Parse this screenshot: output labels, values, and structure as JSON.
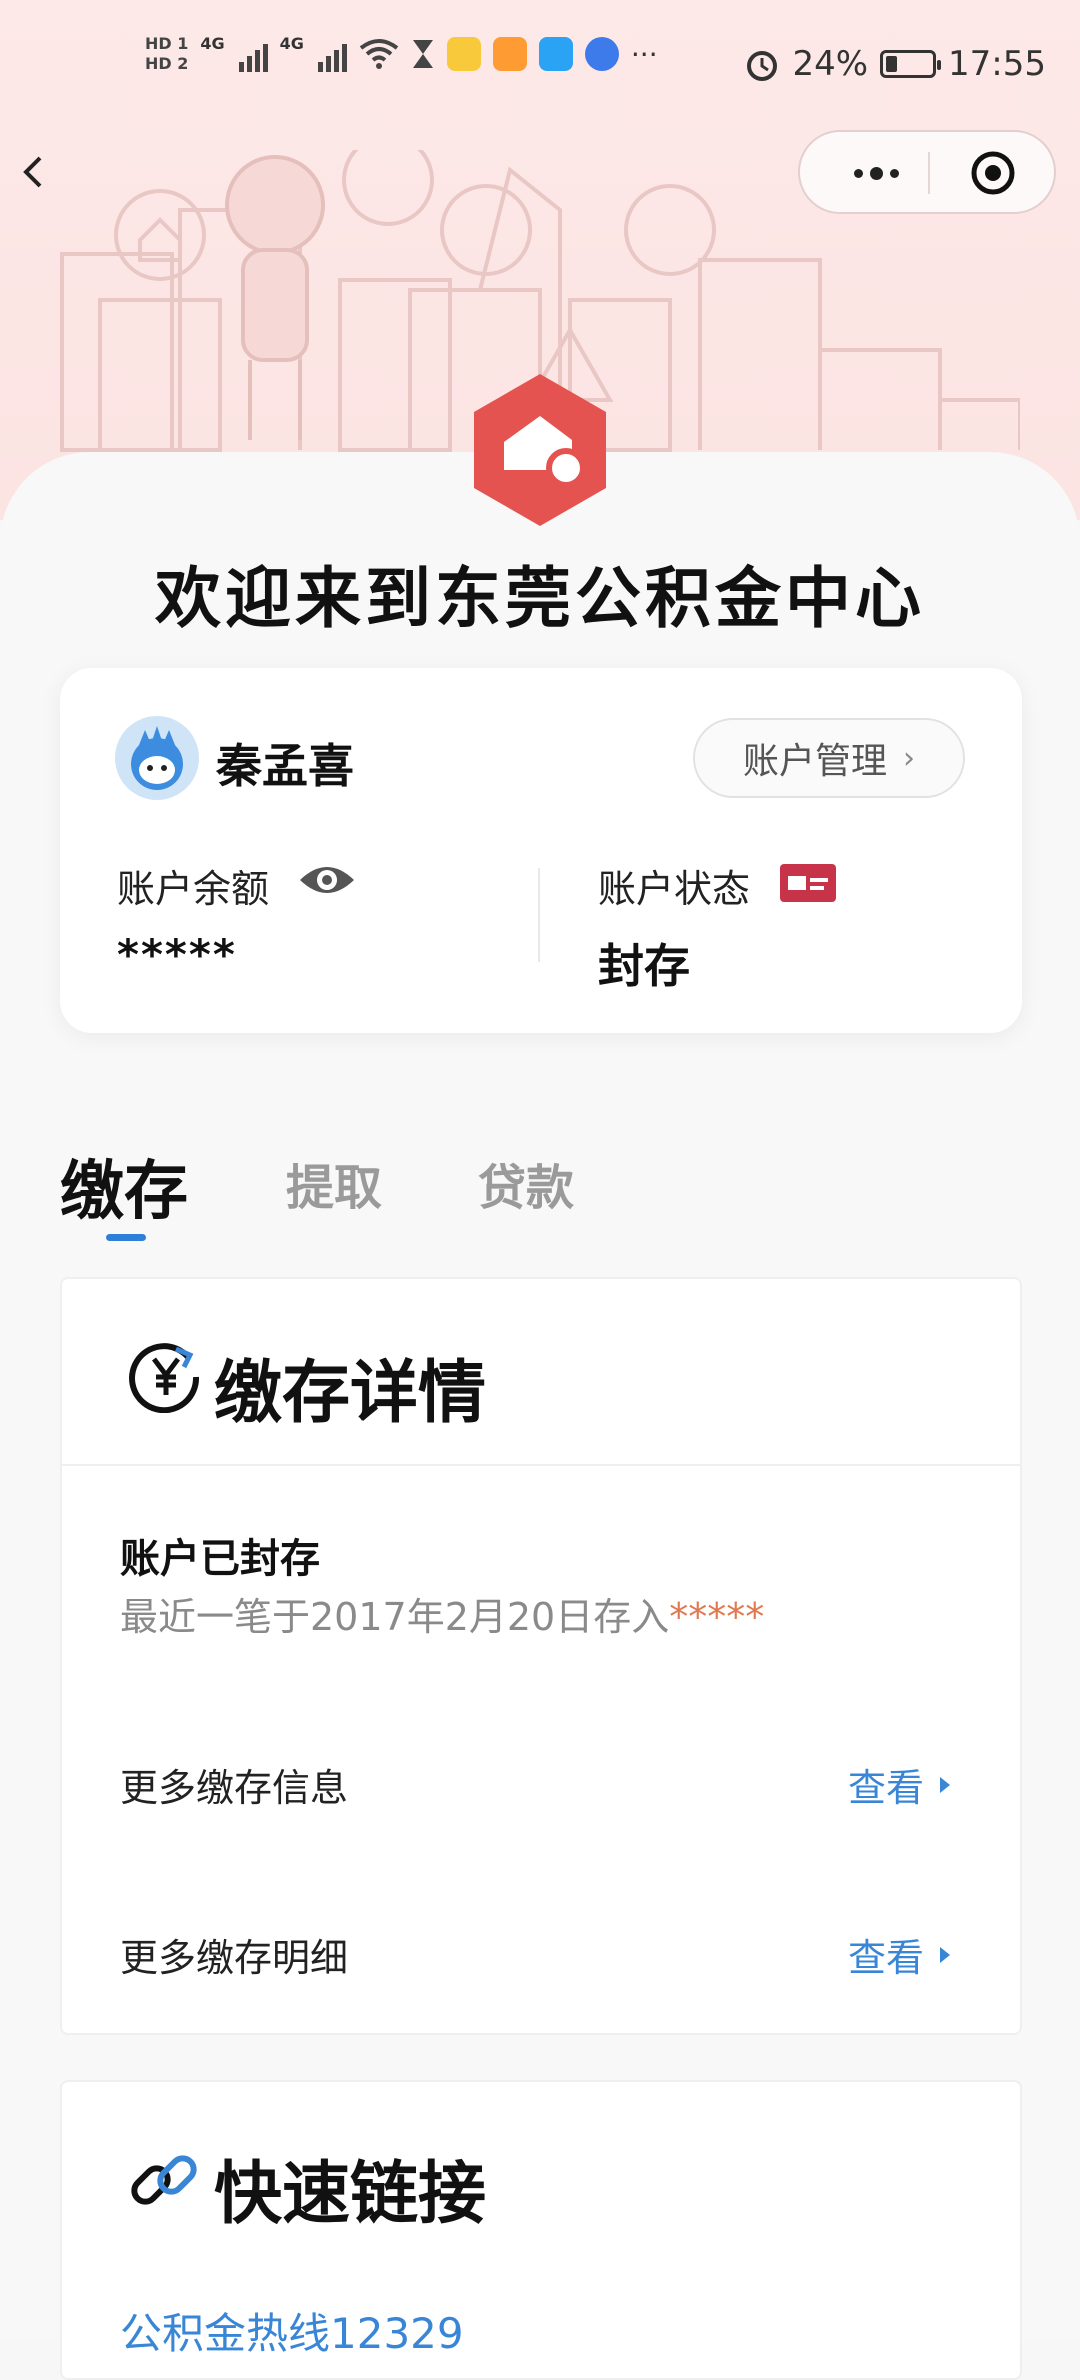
{
  "status_bar": {
    "hd1": "HD 1",
    "hd2": "HD 2",
    "network1": "4G",
    "network2": "4G",
    "more": "···",
    "battery_percent": "24%",
    "battery_level": 0.24,
    "time": "17:55"
  },
  "nav": {
    "back_icon": "chevron-left-icon",
    "more_icon": "more-dots-icon",
    "close_icon": "target-circle-icon"
  },
  "welcome_title": "欢迎来到东莞公积金中心",
  "account": {
    "user_name": "秦孟喜",
    "manage_label": "账户管理",
    "manage_chevron": "›",
    "balance_label": "账户余额",
    "balance_value": "*****",
    "status_label": "账户状态",
    "status_value": "封存"
  },
  "tabs": [
    {
      "label": "缴存",
      "active": true
    },
    {
      "label": "提取",
      "active": false
    },
    {
      "label": "贷款",
      "active": false
    }
  ],
  "deposit_details": {
    "title": "缴存详情",
    "sealed_title": "账户已封存",
    "sealed_sub_prefix": "最近一笔于2017年2月20日存入",
    "sealed_sub_mask": "*****",
    "rows": [
      {
        "label": "更多缴存信息",
        "action": "查看"
      },
      {
        "label": "更多缴存明细",
        "action": "查看"
      }
    ]
  },
  "quick_links": {
    "title": "快速链接",
    "hotline": "公积金热线12329"
  },
  "colors": {
    "brand_red": "#e4534f",
    "link_blue": "#3a86d6",
    "tab_indicator": "#2e7fd8",
    "mask_orange": "#e0794f",
    "hero_bg": "#fde9e8"
  }
}
